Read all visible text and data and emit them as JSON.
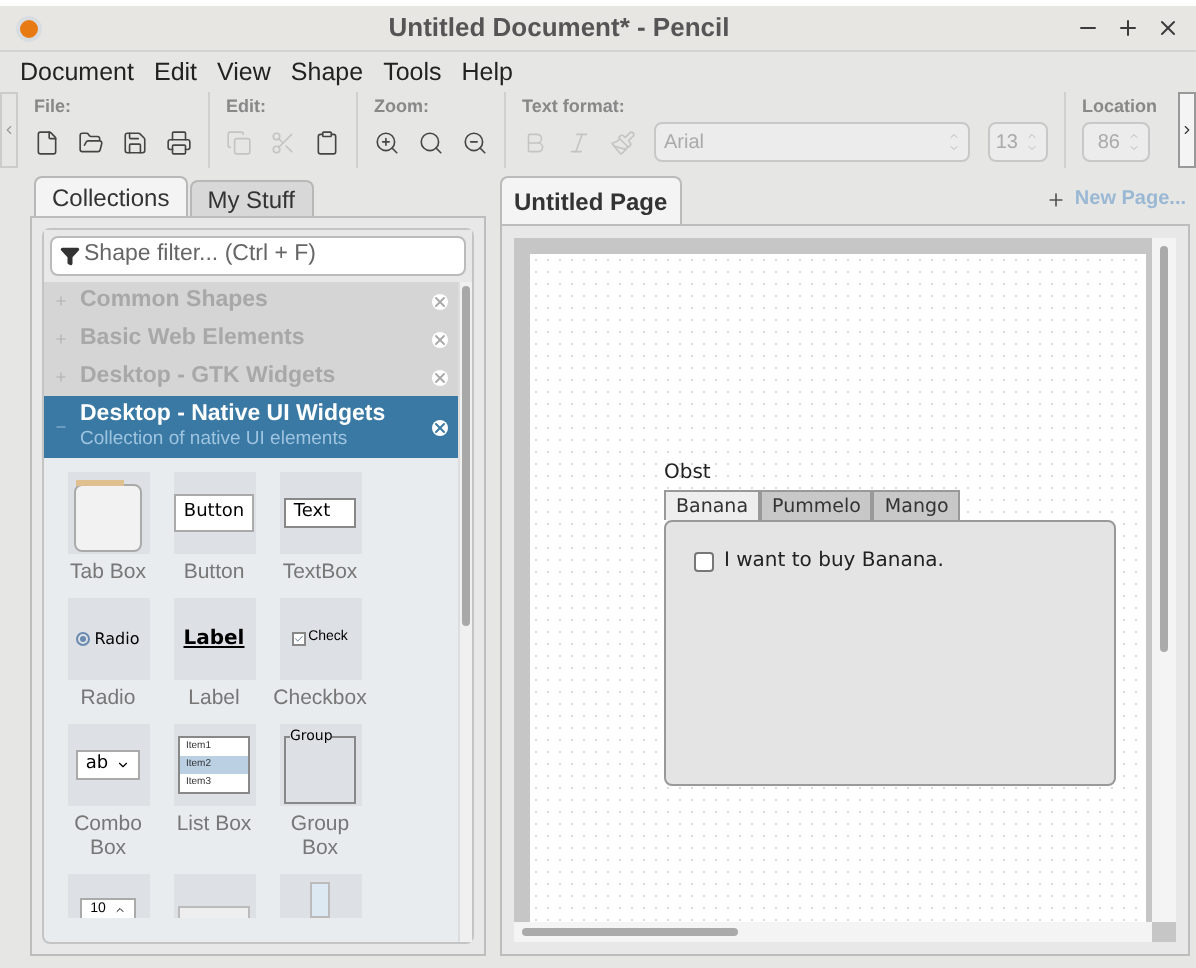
{
  "window": {
    "title": "Untitled Document* - Pencil"
  },
  "menu": [
    "Document",
    "Edit",
    "View",
    "Shape",
    "Tools",
    "Help"
  ],
  "toolbar": {
    "groups": [
      {
        "label": "File:",
        "tools": [
          {
            "kind": "new",
            "disabled": false
          },
          {
            "kind": "open",
            "disabled": false
          },
          {
            "kind": "save",
            "disabled": false
          },
          {
            "kind": "print",
            "disabled": false
          }
        ]
      },
      {
        "label": "Edit:",
        "tools": [
          {
            "kind": "copy",
            "disabled": true
          },
          {
            "kind": "cut",
            "disabled": true
          },
          {
            "kind": "paste",
            "disabled": false
          }
        ]
      },
      {
        "label": "Zoom:",
        "tools": [
          {
            "kind": "zoom-in",
            "disabled": false
          },
          {
            "kind": "zoom-reset",
            "disabled": false
          },
          {
            "kind": "zoom-out",
            "disabled": false
          }
        ]
      },
      {
        "label": "Text format:",
        "tools": [
          {
            "kind": "bold",
            "disabled": true
          },
          {
            "kind": "italic",
            "disabled": true
          },
          {
            "kind": "brush",
            "disabled": true
          }
        ],
        "font": "Arial",
        "size": "13"
      },
      {
        "label": "Location",
        "value": "86"
      }
    ]
  },
  "sidebar": {
    "tabs": [
      {
        "label": "Collections",
        "selected": true
      },
      {
        "label": "My Stuff",
        "selected": false
      }
    ],
    "filter": {
      "placeholder": "Shape filter... (Ctrl + F)"
    },
    "collections": [
      {
        "name": "Common Shapes",
        "expanded": false
      },
      {
        "name": "Basic Web Elements",
        "expanded": false
      },
      {
        "name": "Desktop - GTK Widgets",
        "expanded": false
      },
      {
        "name": "Desktop - Native UI Widgets",
        "expanded": true,
        "description": "Collection of native UI elements"
      }
    ],
    "shapes": [
      {
        "kind": "tabbox",
        "label": "Tab Box"
      },
      {
        "kind": "button",
        "label": "Button",
        "preview": "Button"
      },
      {
        "kind": "textbox",
        "label": "TextBox",
        "preview": "Text"
      },
      {
        "kind": "radio",
        "label": "Radio",
        "preview": "Radio"
      },
      {
        "kind": "label",
        "label": "Label",
        "preview": "Label"
      },
      {
        "kind": "checkbox",
        "label": "Checkbox",
        "preview": "Check"
      },
      {
        "kind": "combo",
        "label": "Combo Box",
        "preview": "ab"
      },
      {
        "kind": "listbox",
        "label": "List Box",
        "items": [
          "Item1",
          "Item2",
          "Item3"
        ]
      },
      {
        "kind": "group",
        "label": "Group Box",
        "preview": "Group"
      },
      {
        "kind": "spinner",
        "preview": "10"
      },
      {
        "kind": "slider"
      },
      {
        "kind": "scrollbar"
      }
    ]
  },
  "pages": {
    "tabs": [
      {
        "label": "Untitled Page",
        "selected": true
      }
    ],
    "new_page": "New Page..."
  },
  "canvas": {
    "title": "Obst",
    "tabs": [
      {
        "label": "Banana",
        "selected": true
      },
      {
        "label": "Pummelo",
        "selected": false
      },
      {
        "label": "Mango",
        "selected": false
      }
    ],
    "checkbox": {
      "label": "I want to buy Banana.",
      "checked": false
    }
  }
}
